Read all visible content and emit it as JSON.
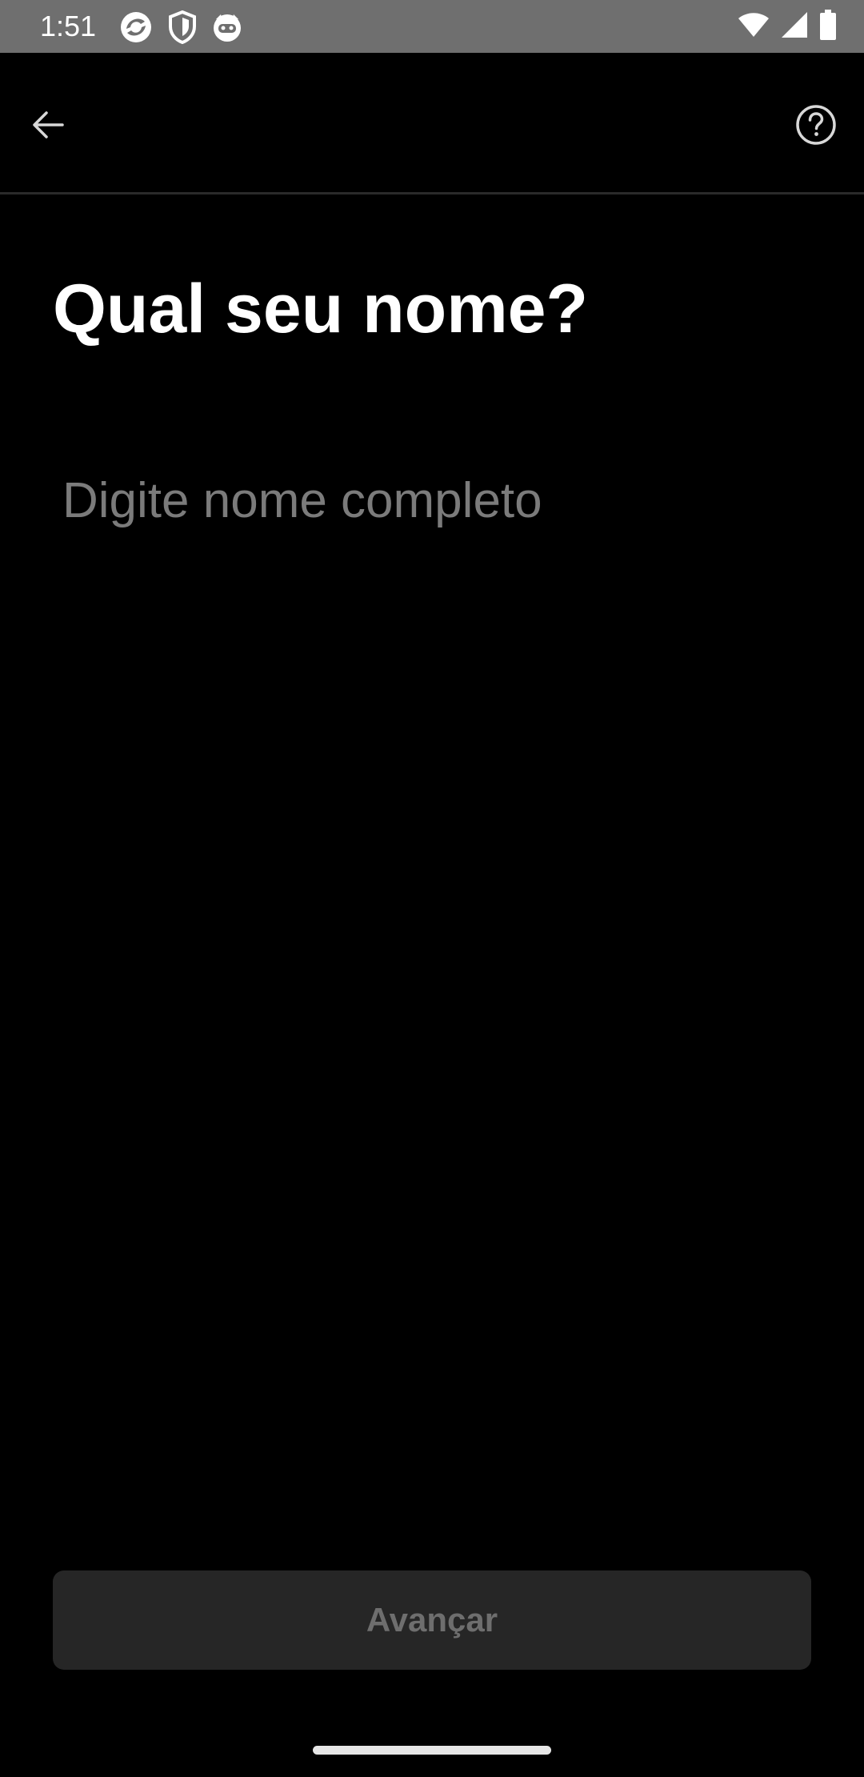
{
  "status_bar": {
    "time": "1:51",
    "left_icons": [
      "sync-app-icon",
      "shield-icon",
      "cat-face-icon"
    ],
    "right_icons": [
      "wifi-icon",
      "cellular-signal-icon",
      "battery-icon"
    ]
  },
  "app_bar": {
    "back_icon": "arrow-left-icon",
    "help_icon": "question-circle-icon"
  },
  "main": {
    "title": "Qual seu nome?",
    "name_input": {
      "value": "",
      "placeholder": "Digite nome completo"
    }
  },
  "footer": {
    "advance_label": "Avançar"
  },
  "colors": {
    "background": "#000000",
    "status_bar": "#6f6f6f",
    "placeholder": "#7b7b7b",
    "button_bg_disabled": "#262626",
    "button_text_disabled": "#6e6e6e"
  }
}
